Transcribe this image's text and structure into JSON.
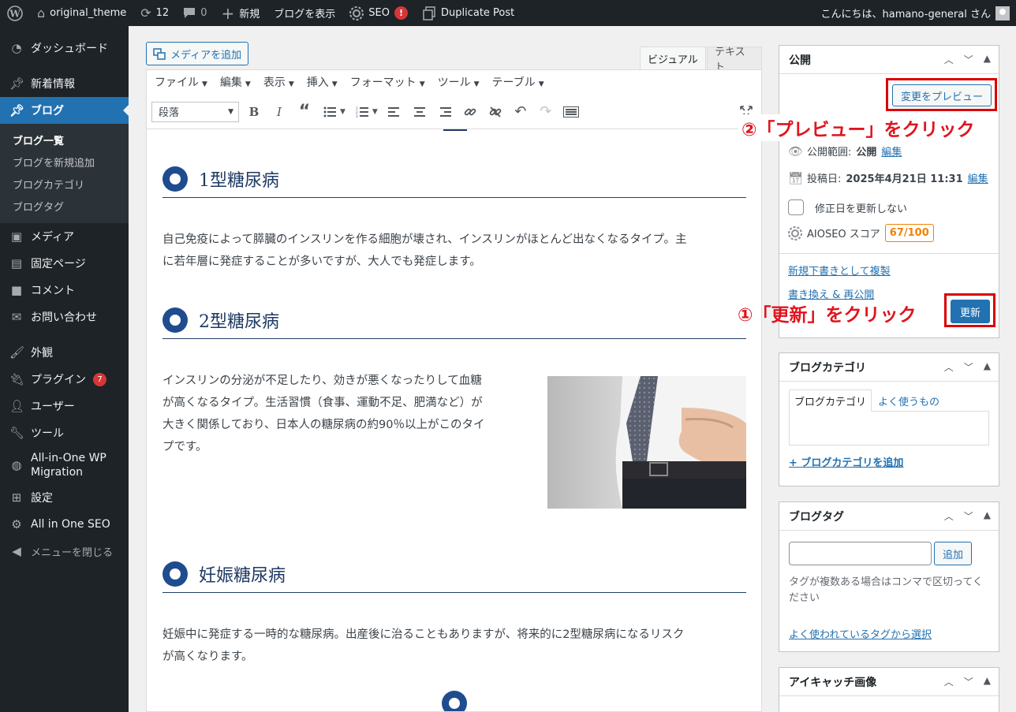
{
  "adminbar": {
    "site_name": "original_theme",
    "updates_count": "12",
    "comments_count": "0",
    "new_label": "新規",
    "view_blog": "ブログを表示",
    "seo_label": "SEO",
    "seo_badge": "!",
    "duplicate_post": "Duplicate Post",
    "greeting": "こんにちは、hamano-general さん"
  },
  "sidebar": {
    "dashboard": "ダッシュボード",
    "news": "新着情報",
    "blog": "ブログ",
    "blog_sub": [
      "ブログ一覧",
      "ブログを新規追加",
      "ブログカテゴリ",
      "ブログタグ"
    ],
    "media": "メディア",
    "pages": "固定ページ",
    "comments": "コメント",
    "contact": "お問い合わせ",
    "appearance": "外観",
    "plugins": "プラグイン",
    "plugins_badge": "7",
    "users": "ユーザー",
    "tools": "ツール",
    "migration_line1": "All-in-One WP",
    "migration_line2": "Migration",
    "settings": "設定",
    "aioseo": "All in One SEO",
    "collapse": "メニューを閉じる"
  },
  "editor": {
    "add_media": "メディアを追加",
    "tab_visual": "ビジュアル",
    "tab_text": "テキスト",
    "menus": [
      "ファイル",
      "編集",
      "表示",
      "挿入",
      "フォーマット",
      "ツール",
      "テーブル"
    ],
    "format_select": "段落",
    "sections": [
      {
        "heading": "1型糖尿病",
        "text": [
          "自己免疫によって膵臓のインスリンを作る細胞が壊され、インスリンがほとんど出なくなるタイプ。主",
          "に若年層に発症することが多いですが、大人でも発症します。"
        ]
      },
      {
        "heading": "2型糖尿病",
        "text": [
          "インスリンの分泌が不足したり、効きが悪くなったりして血糖",
          "が高くなるタイプ。生活習慣（食事、運動不足、肥満など）が",
          "大きく関係しており、日本人の糖尿病の約90％以上がこのタイ",
          "プです。"
        ]
      },
      {
        "heading": "妊娠糖尿病",
        "text": [
          "妊娠中に発症する一時的な糖尿病。出産後に治ることもありますが、将来的に2型糖尿病になるリスク",
          "が高くなります。"
        ]
      }
    ]
  },
  "publish": {
    "title": "公開",
    "preview_btn": "変更をプレビュー",
    "visibility_label": "公開範囲:",
    "visibility_value": "公開",
    "date_label": "投稿日:",
    "date_value": "2025年4月21日 11:31",
    "edit_link": "編集",
    "no_update_date": "修正日を更新しない",
    "aioseo_label": "AIOSEO スコア",
    "aioseo_score": "67/100",
    "copy_draft": "新規下書きとして複製",
    "rewrite": "書き換え & 再公開",
    "update_btn": "更新"
  },
  "annotations": {
    "step1": "①「更新」をクリック",
    "step2": "②「プレビュー」をクリック"
  },
  "category_box": {
    "title": "ブログカテゴリ",
    "tab_all": "ブログカテゴリ",
    "tab_popular": "よく使うもの",
    "add_link": "+ ブログカテゴリを追加"
  },
  "tag_box": {
    "title": "ブログタグ",
    "add_btn": "追加",
    "help": [
      "タグが複数ある場合はコンマで区切ってく",
      "ださい"
    ],
    "choose_link": "よく使われているタグから選択"
  },
  "featured_box": {
    "title": "アイキャッチ画像"
  },
  "colors": {
    "admin_dark": "#1d2327",
    "wp_blue": "#2271b1",
    "heading_navy": "#1f3a64",
    "annotation_red": "#e0141e",
    "score_orange": "#f18200"
  }
}
